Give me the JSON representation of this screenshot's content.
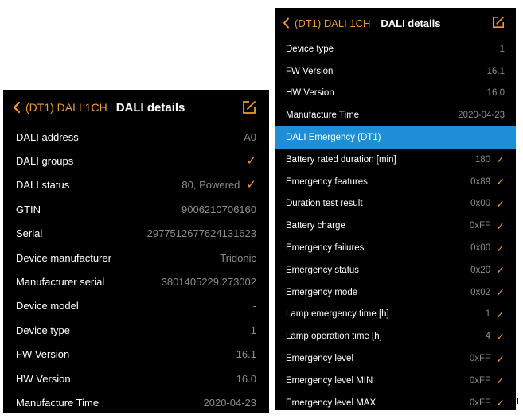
{
  "left": {
    "back_label": "(DT1) DALI 1CH",
    "title": "DALI details",
    "rows": [
      {
        "label": "DALI address",
        "value": "A0",
        "check": false
      },
      {
        "label": "DALI groups",
        "value": "",
        "check": true
      },
      {
        "label": "DALI status",
        "value": "80, Powered",
        "check": true
      },
      {
        "label": "GTIN",
        "value": "9006210706160",
        "check": false
      },
      {
        "label": "Serial",
        "value": "2977512677624131623",
        "check": false
      },
      {
        "label": "Device manufacturer",
        "value": "Tridonic",
        "check": false
      },
      {
        "label": "Manufacturer serial",
        "value": "3801405229.273002",
        "check": false
      },
      {
        "label": "Device model",
        "value": "-",
        "check": false
      },
      {
        "label": "Device type",
        "value": "1",
        "check": false
      },
      {
        "label": "FW Version",
        "value": "16.1",
        "check": false
      },
      {
        "label": "HW Version",
        "value": "16.0",
        "check": false
      },
      {
        "label": "Manufacture Time",
        "value": "2020-04-23",
        "check": false
      }
    ]
  },
  "right": {
    "back_label": "(DT1) DALI 1CH",
    "title": "DALI details",
    "rows": [
      {
        "label": "Device type",
        "value": "1",
        "check": false
      },
      {
        "label": "FW Version",
        "value": "16.1",
        "check": false
      },
      {
        "label": "HW Version",
        "value": "16.0",
        "check": false
      },
      {
        "label": "Manufacture Time",
        "value": "2020-04-23",
        "check": false
      }
    ],
    "section_title": "DALI Emergency (DT1)",
    "emergency_rows": [
      {
        "label": "Battery rated duration [min]",
        "value": "180",
        "check": true
      },
      {
        "label": "Emergency features",
        "value": "0x89",
        "check": true
      },
      {
        "label": "Duration test result",
        "value": "0x00",
        "check": true
      },
      {
        "label": "Battery charge",
        "value": "0xFF",
        "check": true
      },
      {
        "label": "Emergency failures",
        "value": "0x00",
        "check": true
      },
      {
        "label": "Emergency status",
        "value": "0x20",
        "check": true
      },
      {
        "label": "Emergency mode",
        "value": "0x02",
        "check": true
      },
      {
        "label": "Lamp emergency time [h]",
        "value": "1",
        "check": true
      },
      {
        "label": "Lamp operation time [h]",
        "value": "4",
        "check": true
      },
      {
        "label": "Emergency level",
        "value": "0xFF",
        "check": true
      },
      {
        "label": "Emergency level MIN",
        "value": "0xFF",
        "check": true
      },
      {
        "label": "Emergency level MAX",
        "value": "0xFF",
        "check": true
      }
    ]
  },
  "icons": {
    "back": "chevron-left-icon",
    "edit": "edit-icon",
    "check": "checkmark-icon"
  },
  "colors": {
    "accent": "#f09a37",
    "background": "#000000",
    "section": "#1e8fd6",
    "value": "#8c8c8c"
  }
}
